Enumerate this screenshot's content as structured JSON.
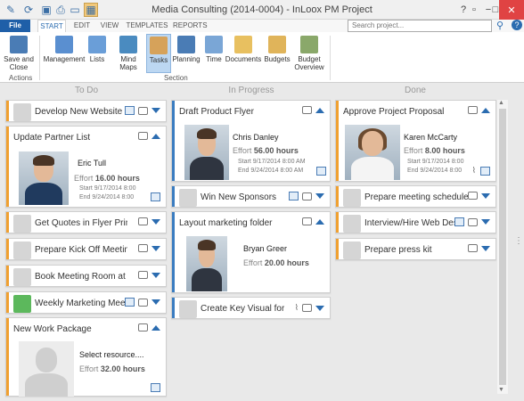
{
  "window": {
    "title": "Media Consulting (2014-0004) - InLoox PM Project",
    "controls": {
      "help": "?",
      "restore": "▫",
      "minimize": "−",
      "maximize": "□",
      "close": "✕"
    }
  },
  "ribbon_tabs": {
    "file": "File",
    "start": "START",
    "edit": "EDIT",
    "view": "VIEW",
    "templates": "TEMPLATES",
    "reports": "REPORTS"
  },
  "search": {
    "placeholder": "Search project..."
  },
  "ribbon": {
    "save_close": "Save and Close",
    "actions_group": "Actions",
    "section_group": "Section",
    "buttons": [
      "Management",
      "Lists",
      "Mind Maps",
      "Tasks",
      "Planning",
      "Time",
      "Documents",
      "Budgets",
      "Budget Overview"
    ]
  },
  "columns": {
    "todo": "To Do",
    "inprogress": "In Progress",
    "done": "Done"
  },
  "labels": {
    "effort": "Effort",
    "start": "Start",
    "end": "End"
  },
  "todo": {
    "c1": "Develop New Website D...",
    "c2": {
      "title": "Update Partner List",
      "person": "Eric Tull",
      "effort": "16.00 hours",
      "start": "9/17/2014 8:00",
      "end": "9/24/2014 8:00"
    },
    "c3": "Get Quotes in Flyer Prints",
    "c4": "Prepare Kick Off Meeting",
    "c5": "Book Meeting Room at ...",
    "c6": "Weekly Marketing Meeting",
    "c7": {
      "title": "New Work Package",
      "person": "Select resource....",
      "effort": "32.00 hours"
    }
  },
  "inprogress": {
    "c1": {
      "title": "Draft Product Flyer",
      "person": "Chris Danley",
      "effort": "56.00 hours",
      "start": "9/17/2014 8:00 AM",
      "end": "9/24/2014 8:00 AM"
    },
    "c2": "Win New Sponsors",
    "c3": {
      "title": "Layout marketing folder",
      "person": "Bryan Greer",
      "effort": "20.00 hours"
    },
    "c4": "Create Key Visual for Tra..."
  },
  "done": {
    "c1": {
      "title": "Approve Project Proposal",
      "person": "Karen McCarty",
      "effort": "8.00 hours",
      "start": "9/17/2014 8:00",
      "end": "9/24/2014 8:00"
    },
    "c2": "Prepare meeting schedule a...",
    "c3": "Interview/Hire Web Desi...",
    "c4": "Prepare press kit"
  },
  "colors": {
    "accent": "#2b6cb0",
    "orange_bar": "#f0a030",
    "blue_bar": "#3a7cc0",
    "close": "#e04343"
  }
}
